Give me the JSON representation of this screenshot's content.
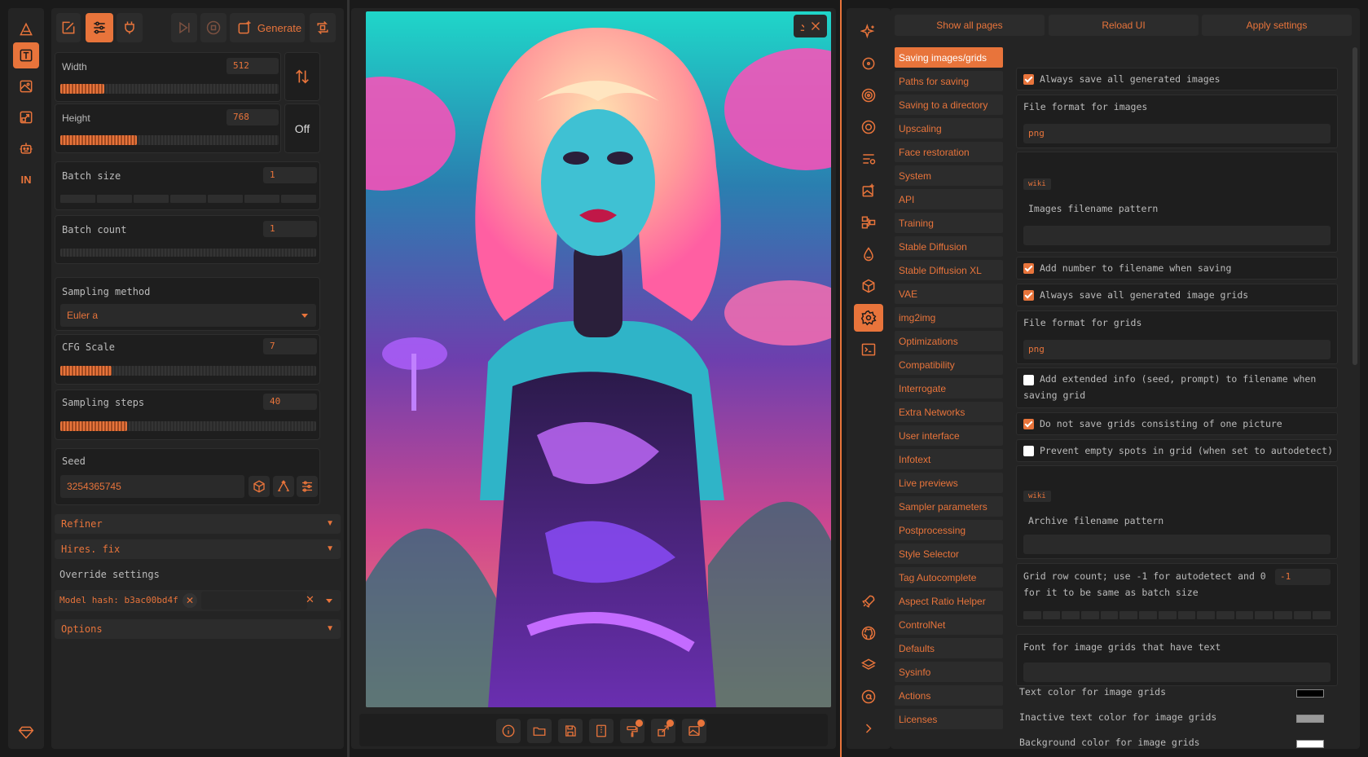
{
  "left_rail": {
    "items": [
      {
        "name": "logo-icon"
      },
      {
        "name": "txt2img-icon",
        "active": true
      },
      {
        "name": "img2img-icon"
      },
      {
        "name": "extras-icon"
      },
      {
        "name": "robot-icon"
      },
      {
        "name": "in-label",
        "label": "IN"
      },
      {
        "name": "diamond-icon"
      }
    ]
  },
  "toolbar": {
    "generate_label": "Generate"
  },
  "params": {
    "width": {
      "label": "Width",
      "value": "512",
      "fraction": 0.2
    },
    "height": {
      "label": "Height",
      "value": "768",
      "fraction": 0.35
    },
    "swap_label": "Off",
    "batch_size": {
      "label": "Batch size",
      "value": "1"
    },
    "batch_count": {
      "label": "Batch count",
      "value": "1"
    },
    "sampling_method": {
      "label": "Sampling method",
      "value": "Euler a"
    },
    "cfg_scale": {
      "label": "CFG Scale",
      "value": "7",
      "fraction": 0.2
    },
    "sampling_steps": {
      "label": "Sampling steps",
      "value": "40",
      "fraction": 0.26
    },
    "seed": {
      "label": "Seed",
      "value": "3254365745"
    },
    "refiner_label": "Refiner",
    "hires_label": "Hires. fix",
    "override_label": "Override settings",
    "override_chip": "Model hash: b3ac00bd4f",
    "options_label": "Options"
  },
  "settings": {
    "top_buttons": [
      "Show all pages",
      "Reload UI",
      "Apply settings"
    ],
    "categories": [
      "Saving images/grids",
      "Paths for saving",
      "Saving to a directory",
      "Upscaling",
      "Face restoration",
      "System",
      "API",
      "Training",
      "Stable Diffusion",
      "Stable Diffusion XL",
      "VAE",
      "img2img",
      "Optimizations",
      "Compatibility",
      "Interrogate",
      "Extra Networks",
      "User interface",
      "Infotext",
      "Live previews",
      "Sampler parameters",
      "Postprocessing",
      "Style Selector",
      "Tag Autocomplete",
      "Aspect Ratio Helper",
      "ControlNet",
      "Defaults",
      "Sysinfo",
      "Actions",
      "Licenses"
    ],
    "active_category": "Saving images/grids",
    "always_save_images": "Always save all generated images",
    "file_format_images_label": "File format for images",
    "file_format_images_value": "png",
    "wiki_tag": "wiki",
    "images_filename_pattern": "Images filename pattern",
    "add_number": "Add number to filename when saving",
    "always_save_grids": "Always save all generated image grids",
    "file_format_grids_label": "File format for grids",
    "file_format_grids_value": "png",
    "add_extended_info_1": "Add extended info (seed, prompt) to filename when",
    "add_extended_info_2": "saving grid",
    "no_single_grid": "Do not save grids consisting of one picture",
    "prevent_empty": "Prevent empty spots in grid (when set to autodetect)",
    "archive_filename_pattern": "Archive filename pattern",
    "grid_row_count_1": "Grid row count; use -1 for autodetect and 0",
    "grid_row_count_2": "for it to be same as batch size",
    "grid_row_count_value": "-1",
    "font_for_grids": "Font for image grids that have text",
    "text_color": "Text color for image grids",
    "inactive_text_color": "Inactive text color for image grids",
    "background_color": "Background color for image grids",
    "swatch_colors": [
      "#000000",
      "#999999",
      "#ffffff"
    ]
  },
  "colors": {
    "accent": "#e8743b",
    "background": "#1a1a1a",
    "panel": "#242424"
  }
}
